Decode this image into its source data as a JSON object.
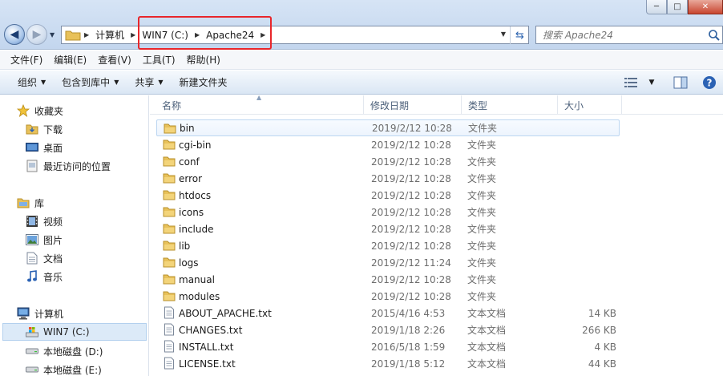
{
  "window": {
    "controls": {
      "minimize": "─",
      "maximize": "□",
      "close": "✕"
    }
  },
  "address": {
    "crumbs": [
      "计算机",
      "WIN7 (C:)",
      "Apache24"
    ]
  },
  "search": {
    "placeholder": "搜索 Apache24"
  },
  "menu": [
    "文件(F)",
    "编辑(E)",
    "查看(V)",
    "工具(T)",
    "帮助(H)"
  ],
  "commands": {
    "organize": "组织",
    "include_in_library": "包含到库中",
    "share": "共享",
    "new_folder": "新建文件夹"
  },
  "nav": {
    "favorites": "收藏夹",
    "downloads": "下载",
    "desktop": "桌面",
    "recent": "最近访问的位置",
    "libraries": "库",
    "videos": "视频",
    "pictures": "图片",
    "documents": "文档",
    "music": "音乐",
    "computer": "计算机",
    "drive_c": "WIN7 (C:)",
    "drive_d": "本地磁盘 (D:)",
    "drive_e": "本地磁盘 (E:)"
  },
  "columns": {
    "name": "名称",
    "date": "修改日期",
    "type": "类型",
    "size": "大小"
  },
  "files": [
    {
      "name": "bin",
      "date": "2019/2/12 10:28",
      "type": "文件夹",
      "size": "",
      "kind": "folder"
    },
    {
      "name": "cgi-bin",
      "date": "2019/2/12 10:28",
      "type": "文件夹",
      "size": "",
      "kind": "folder"
    },
    {
      "name": "conf",
      "date": "2019/2/12 10:28",
      "type": "文件夹",
      "size": "",
      "kind": "folder"
    },
    {
      "name": "error",
      "date": "2019/2/12 10:28",
      "type": "文件夹",
      "size": "",
      "kind": "folder"
    },
    {
      "name": "htdocs",
      "date": "2019/2/12 10:28",
      "type": "文件夹",
      "size": "",
      "kind": "folder"
    },
    {
      "name": "icons",
      "date": "2019/2/12 10:28",
      "type": "文件夹",
      "size": "",
      "kind": "folder"
    },
    {
      "name": "include",
      "date": "2019/2/12 10:28",
      "type": "文件夹",
      "size": "",
      "kind": "folder"
    },
    {
      "name": "lib",
      "date": "2019/2/12 10:28",
      "type": "文件夹",
      "size": "",
      "kind": "folder"
    },
    {
      "name": "logs",
      "date": "2019/2/12 11:24",
      "type": "文件夹",
      "size": "",
      "kind": "folder"
    },
    {
      "name": "manual",
      "date": "2019/2/12 10:28",
      "type": "文件夹",
      "size": "",
      "kind": "folder"
    },
    {
      "name": "modules",
      "date": "2019/2/12 10:28",
      "type": "文件夹",
      "size": "",
      "kind": "folder"
    },
    {
      "name": "ABOUT_APACHE.txt",
      "date": "2015/4/16 4:53",
      "type": "文本文档",
      "size": "14 KB",
      "kind": "text"
    },
    {
      "name": "CHANGES.txt",
      "date": "2019/1/18 2:26",
      "type": "文本文档",
      "size": "266 KB",
      "kind": "text"
    },
    {
      "name": "INSTALL.txt",
      "date": "2016/5/18 1:59",
      "type": "文本文档",
      "size": "4 KB",
      "kind": "text"
    },
    {
      "name": "LICENSE.txt",
      "date": "2019/1/18 5:12",
      "type": "文本文档",
      "size": "44 KB",
      "kind": "text"
    }
  ],
  "colors": {
    "highlight": "#e8262b",
    "folder": "#e8c15a",
    "selection": "#dceaf8"
  }
}
